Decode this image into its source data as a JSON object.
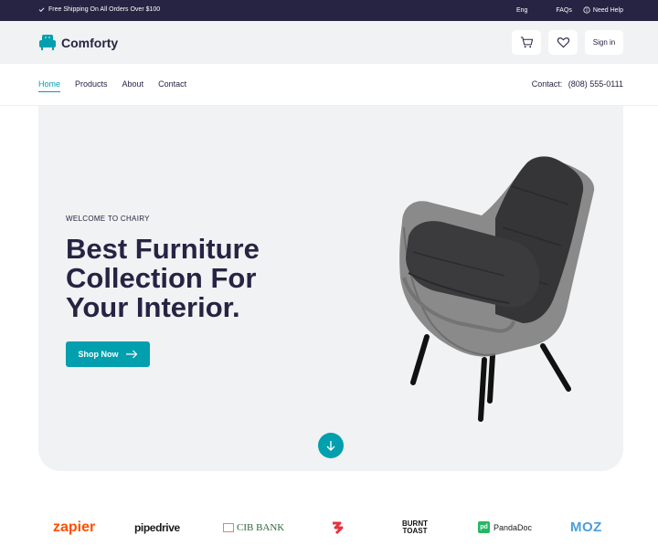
{
  "topbar": {
    "shipping_text": "Free Shipping On All Orders Over $100",
    "language": "Eng",
    "faqs_label": "FAQs",
    "help_label": "Need Help"
  },
  "header": {
    "brand_name": "Comforty",
    "signin_label": "Sign in"
  },
  "nav": {
    "links": [
      "Home",
      "Products",
      "About",
      "Contact"
    ],
    "active_link": "Home",
    "contact_label": "Contact:",
    "contact_phone": "(808) 555-0111"
  },
  "hero": {
    "eyebrow": "WELCOME TO CHAIRY",
    "title_lines": [
      "Best Furniture",
      "Collection For",
      "Your Interior."
    ],
    "cta_label": "Shop Now"
  },
  "brands": {
    "zapier": "zapier",
    "pipedrive": "pipedrive",
    "cib": "CIB BANK",
    "burnt_toast_lines": [
      "BURNT",
      "TOAST"
    ],
    "pandadoc": "PandaDoc",
    "moz": "MOZ"
  },
  "colors": {
    "primary": "#029fae",
    "dark": "#272343",
    "light_bg": "#f0f2f3",
    "active_nav": "#029fae"
  },
  "icons": {
    "shipping": "check-icon",
    "language": "chevron-down-icon",
    "help": "info-icon",
    "logo": "armchair-icon",
    "cart": "cart-icon",
    "wishlist": "heart-icon",
    "cta": "arrow-right-icon",
    "scroll": "arrow-down-icon"
  }
}
